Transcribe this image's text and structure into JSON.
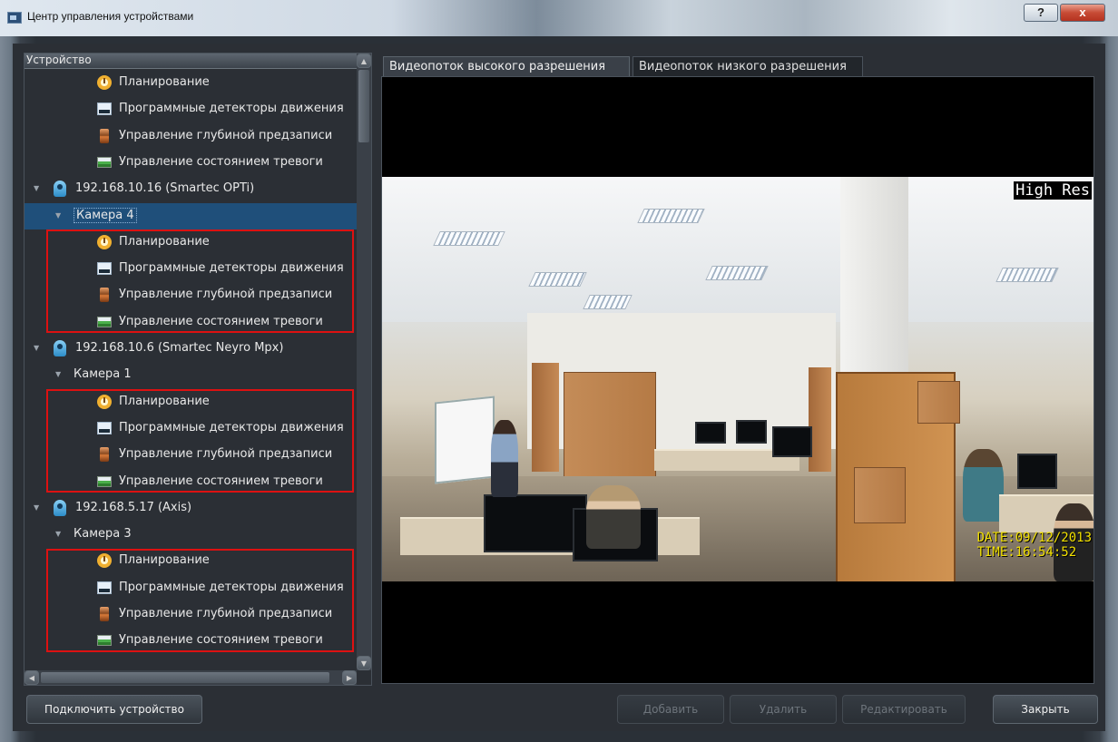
{
  "window": {
    "title": "Центр управления устройствами",
    "help_label": "?",
    "close_label": "x"
  },
  "tree": {
    "header": "Устройство",
    "items": [
      {
        "type": "task",
        "icon": "clock-icon",
        "label": "Планирование"
      },
      {
        "type": "task",
        "icon": "monitor-icon",
        "label": "Программные детекторы движения"
      },
      {
        "type": "task",
        "icon": "hourglass-icon",
        "label": "Управление глубиной предзаписи"
      },
      {
        "type": "task",
        "icon": "alarm-icon",
        "label": "Управление состоянием тревоги"
      },
      {
        "type": "device",
        "icon": "camera-icon",
        "label": "192.168.10.16 (Smartec OPTi)"
      },
      {
        "type": "camera",
        "label": "Камера 4",
        "selected": true
      },
      {
        "type": "task",
        "icon": "clock-icon",
        "label": "Планирование"
      },
      {
        "type": "task",
        "icon": "monitor-icon",
        "label": "Программные детекторы движения"
      },
      {
        "type": "task",
        "icon": "hourglass-icon",
        "label": "Управление глубиной предзаписи"
      },
      {
        "type": "task",
        "icon": "alarm-icon",
        "label": "Управление состоянием тревоги"
      },
      {
        "type": "device",
        "icon": "camera-icon",
        "label": "192.168.10.6 (Smartec Neyro Mpx)"
      },
      {
        "type": "camera",
        "label": "Камера 1"
      },
      {
        "type": "task",
        "icon": "clock-icon",
        "label": "Планирование"
      },
      {
        "type": "task",
        "icon": "monitor-icon",
        "label": "Программные детекторы движения"
      },
      {
        "type": "task",
        "icon": "hourglass-icon",
        "label": "Управление глубиной предзаписи"
      },
      {
        "type": "task",
        "icon": "alarm-icon",
        "label": "Управление состоянием тревоги"
      },
      {
        "type": "device",
        "icon": "camera-icon",
        "label": "192.168.5.17 (Axis)"
      },
      {
        "type": "camera",
        "label": "Камера 3"
      },
      {
        "type": "task",
        "icon": "clock-icon",
        "label": "Планирование"
      },
      {
        "type": "task",
        "icon": "monitor-icon",
        "label": "Программные детекторы движения"
      },
      {
        "type": "task",
        "icon": "hourglass-icon",
        "label": "Управление глубиной предзаписи"
      },
      {
        "type": "task",
        "icon": "alarm-icon",
        "label": "Управление состоянием тревоги"
      }
    ]
  },
  "tabs": [
    {
      "label": "Видеопоток высокого разрешения",
      "active": true
    },
    {
      "label": "Видеопоток низкого разрешения",
      "active": false
    }
  ],
  "video": {
    "overlay_resolution": "High Res",
    "overlay_date": "DATE:09/12/2013",
    "overlay_time": "TIME:16:54:52"
  },
  "buttons": {
    "connect": "Подключить устройство",
    "add": "Добавить",
    "delete": "Удалить",
    "edit": "Редактировать",
    "close": "Закрыть"
  },
  "colors": {
    "highlight_box": "#dd1111",
    "selection": "#1f4f7a",
    "background": "#2b2f35"
  }
}
